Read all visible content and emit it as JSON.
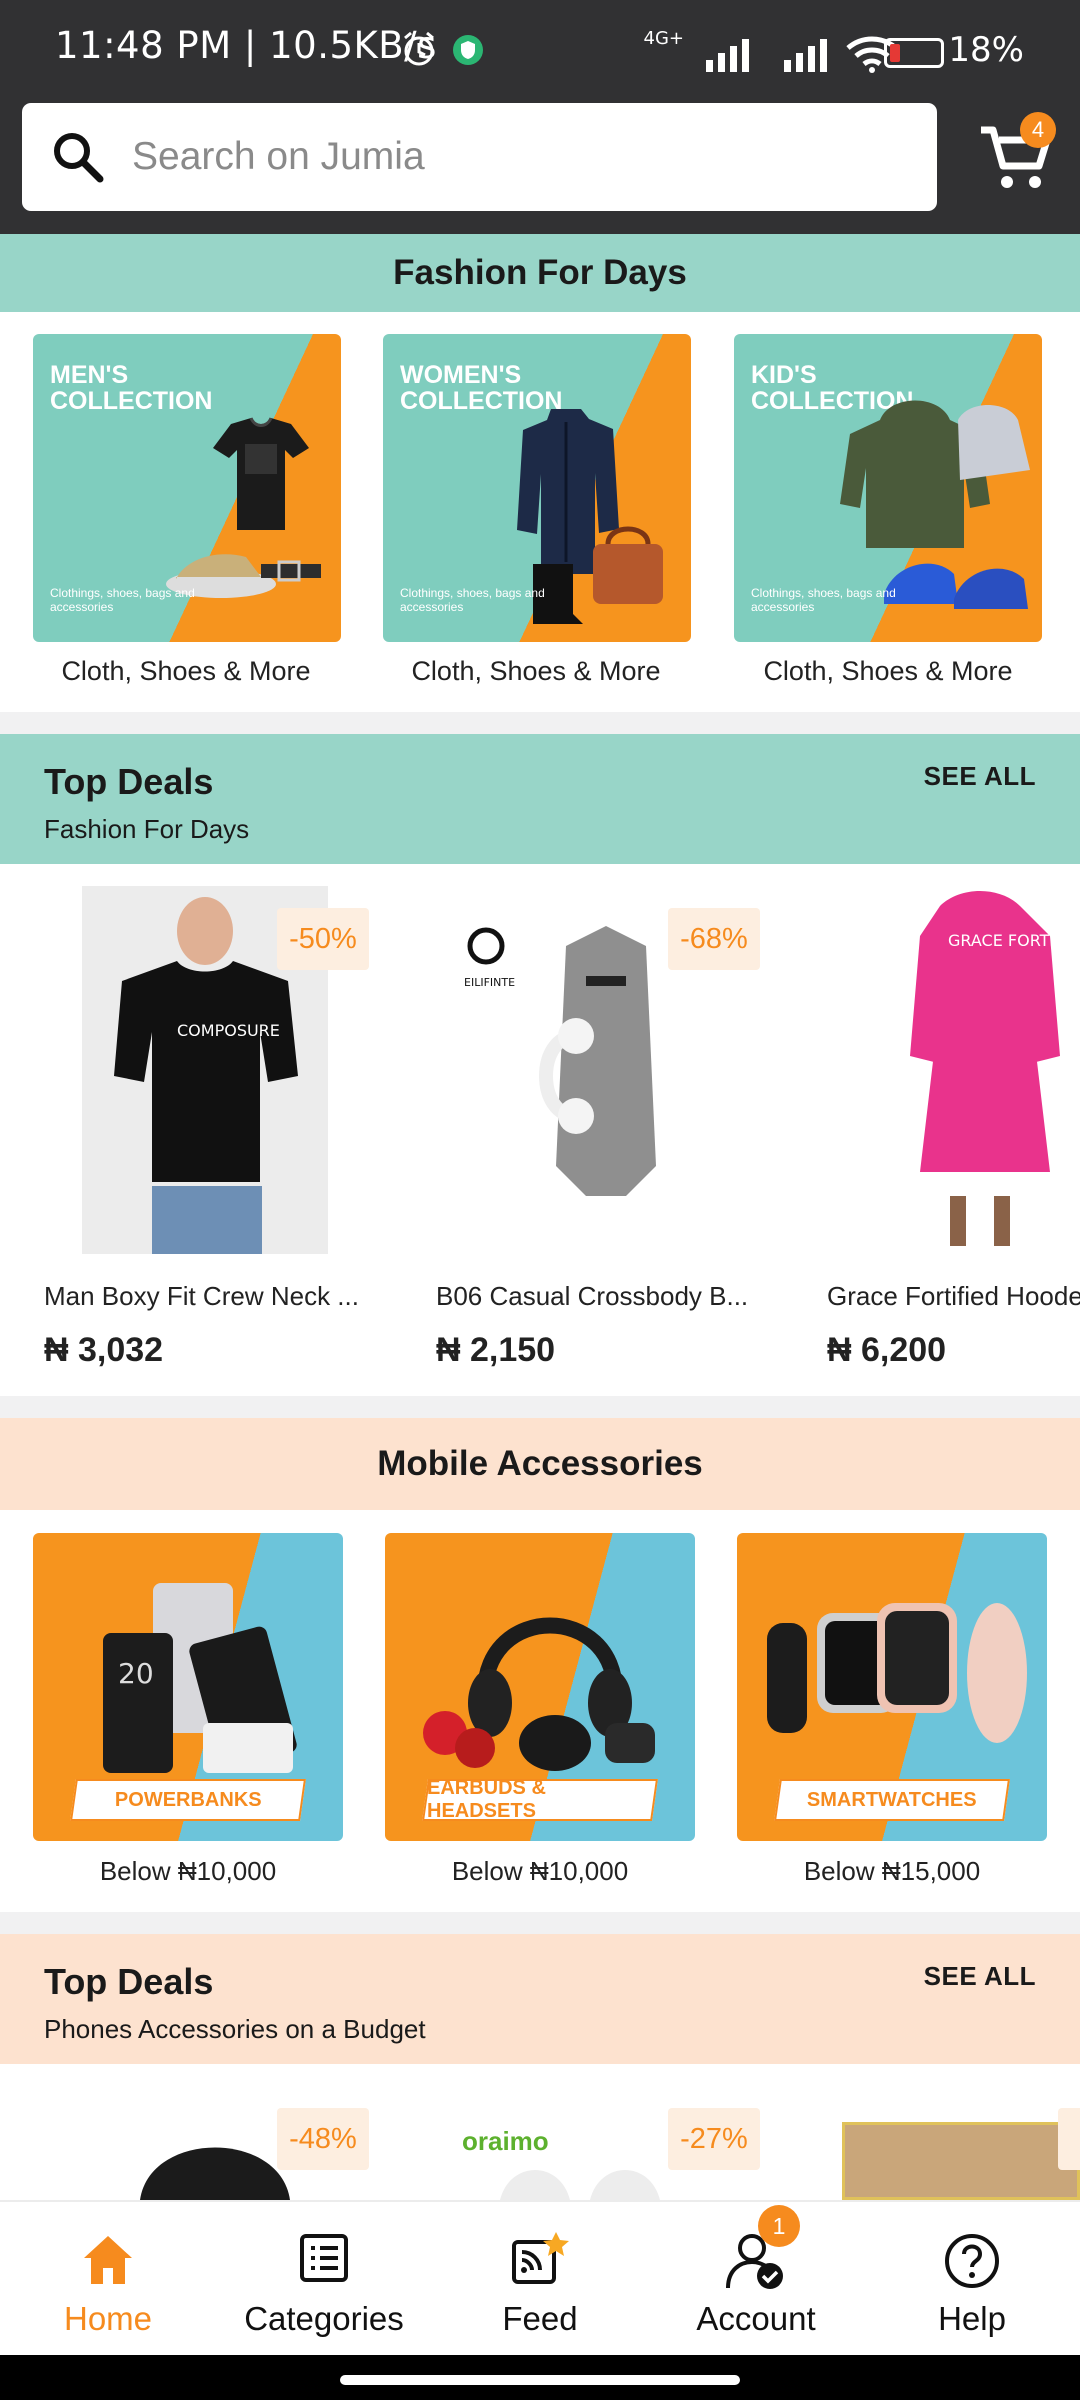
{
  "status_bar": {
    "time": "11:48 PM | 10.5KB/s",
    "network": "4G+",
    "battery": "18%"
  },
  "search": {
    "placeholder": "Search on Jumia",
    "cart_count": "4"
  },
  "fashion_section": {
    "title": "Fashion For Days",
    "tiles": [
      {
        "title": "MEN'S\nCOLLECTION",
        "subtitle": "Clothings, shoes, bags and accessories",
        "caption": "Cloth, Shoes & More"
      },
      {
        "title": "WOMEN'S\nCOLLECTION",
        "subtitle": "Clothings, shoes, bags and accessories",
        "caption": "Cloth, Shoes & More"
      },
      {
        "title": "KID'S\nCOLLECTION",
        "subtitle": "Clothings, shoes, bags and accessories",
        "caption": "Cloth, Shoes & More"
      }
    ]
  },
  "top_deals_fashion": {
    "title": "Top Deals",
    "subtitle": "Fashion For Days",
    "see_all": "SEE ALL",
    "products": [
      {
        "name": "Man Boxy Fit Crew Neck ...",
        "price": "₦ 3,032",
        "discount": "-50%",
        "print": "COMPOSURE"
      },
      {
        "name": "B06 Casual Crossbody B...",
        "price": "₦ 2,150",
        "discount": "-68%",
        "brand": "EILIFINTE"
      },
      {
        "name": "Grace Fortified Hoode",
        "price": "₦ 6,200",
        "print": "GRACE FORTIFIED"
      }
    ]
  },
  "mobile_accessories": {
    "title": "Mobile Accessories",
    "tiles": [
      {
        "label": "POWERBANKS",
        "caption": "Below ₦10,000"
      },
      {
        "label": "EARBUDS & HEADSETS",
        "caption": "Below ₦10,000"
      },
      {
        "label": "SMARTWATCHES",
        "caption": "Below ₦15,000"
      }
    ]
  },
  "top_deals_phones": {
    "title": "Top Deals",
    "subtitle": "Phones Accessories on a Budget",
    "see_all": "SEE ALL",
    "products": [
      {
        "discount": "-48%"
      },
      {
        "discount": "-27%",
        "brand": "oraimo"
      }
    ]
  },
  "bottom_nav": {
    "items": [
      {
        "label": "Home"
      },
      {
        "label": "Categories"
      },
      {
        "label": "Feed"
      },
      {
        "label": "Account"
      },
      {
        "label": "Help"
      }
    ],
    "account_badge": "1"
  },
  "colors": {
    "accent": "#f68b1e",
    "mint": "#98d5c8",
    "peach": "#fde2cf",
    "header": "#313133",
    "tile_blue": "#6cc4da"
  }
}
